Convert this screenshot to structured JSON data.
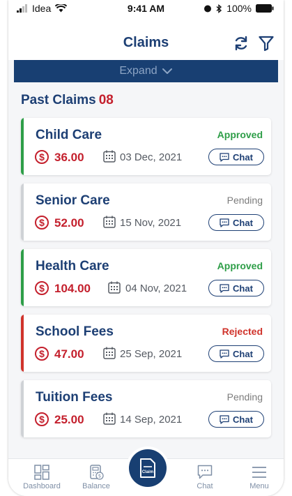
{
  "status_bar": {
    "carrier": "Idea",
    "time": "9:41 AM",
    "battery": "100%"
  },
  "header": {
    "title": "Claims",
    "refresh_icon": "refresh-icon",
    "filter_icon": "filter-icon"
  },
  "expand": {
    "label": "Expand"
  },
  "section": {
    "title": "Past Claims",
    "count": "08"
  },
  "claims": [
    {
      "title": "Child Care",
      "status": "Approved",
      "amount": "36.00",
      "date": "03 Dec, 2021",
      "chat": "Chat"
    },
    {
      "title": "Senior Care",
      "status": "Pending",
      "amount": "52.00",
      "date": "15 Nov, 2021",
      "chat": "Chat"
    },
    {
      "title": "Health Care",
      "status": "Approved",
      "amount": "104.00",
      "date": "04 Nov, 2021",
      "chat": "Chat"
    },
    {
      "title": "School Fees",
      "status": "Rejected",
      "amount": "47.00",
      "date": "25 Sep, 2021",
      "chat": "Chat"
    },
    {
      "title": "Tuition Fees",
      "status": "Pending",
      "amount": "25.00",
      "date": "14 Sep, 2021",
      "chat": "Chat"
    }
  ],
  "tabbar": {
    "dashboard": "Dashboard",
    "balance": "Balance",
    "claim": "Claim",
    "chat": "Chat",
    "menu": "Menu"
  },
  "colors": {
    "brand": "#1d3f74",
    "navy": "#183f72",
    "approved": "#2e9e48",
    "pending": "#7c7c7c",
    "rejected": "#d0332b",
    "amount": "#c4202d",
    "tab_inactive": "#7f8fa6"
  }
}
